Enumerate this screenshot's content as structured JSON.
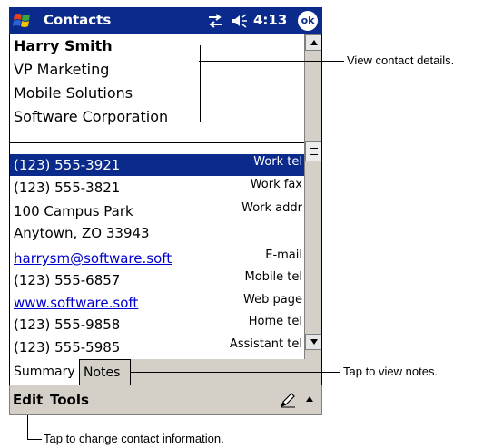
{
  "titlebar": {
    "app_title": "Contacts",
    "time": "4:13",
    "ok_label": "ok",
    "start_icon": "windows-flag-icon",
    "sync_icon": "connectivity-icon",
    "volume_icon": "speaker-icon"
  },
  "contact": {
    "name": "Harry Smith",
    "title": "VP Marketing",
    "department": "Mobile Solutions",
    "company": "Software Corporation"
  },
  "rows": [
    {
      "value": "(123) 555-3921",
      "label": "Work tel",
      "selected": true
    },
    {
      "value": "(123) 555-3821",
      "label": "Work fax"
    },
    {
      "value": "100 Campus Park",
      "label": "Work addr"
    },
    {
      "value": "Anytown, ZO 33943",
      "label": ""
    },
    {
      "value": "harrysm@software.soft",
      "label": "E-mail",
      "link": true
    },
    {
      "value": "(123) 555-6857",
      "label": "Mobile tel"
    },
    {
      "value": "www.software.soft",
      "label": "Web page",
      "link": true
    },
    {
      "value": "(123) 555-9858",
      "label": "Home tel"
    },
    {
      "value": "(123) 555-5985",
      "label": "Assistant tel"
    }
  ],
  "tabs": {
    "summary": "Summary",
    "notes": "Notes"
  },
  "menubar": {
    "edit": "Edit",
    "tools": "Tools",
    "pen_icon": "pen-icon",
    "sip_icon": "input-panel-arrow-icon"
  },
  "callouts": {
    "details": "View contact details.",
    "notes": "Tap to view notes.",
    "change": "Tap to change contact information."
  },
  "colors": {
    "titlebar": "#0a2a8c",
    "selection": "#0a2a8c",
    "link": "#0000cc",
    "chrome": "#d4d0c8"
  }
}
